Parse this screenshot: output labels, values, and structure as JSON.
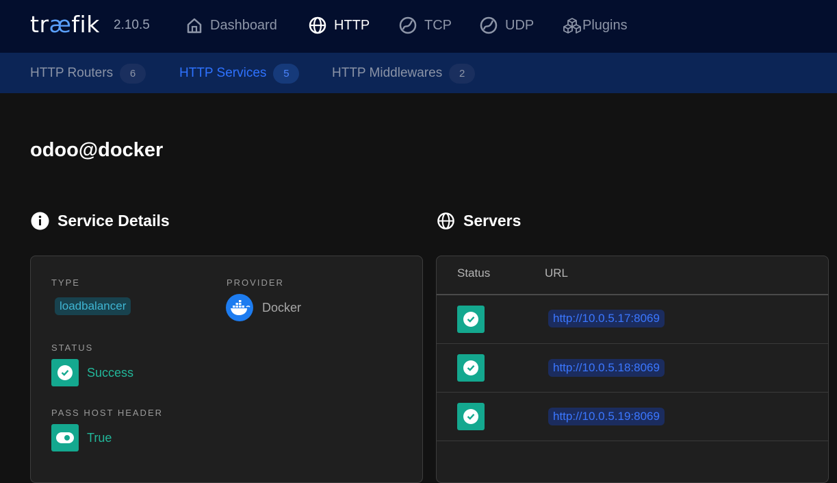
{
  "brand": {
    "logo_pre": "tr",
    "logo_ae": "æ",
    "logo_post": "fik",
    "version": "2.10.5"
  },
  "nav": {
    "dashboard": "Dashboard",
    "http": "HTTP",
    "tcp": "TCP",
    "udp": "UDP",
    "plugins": "Plugins"
  },
  "subnav": {
    "routers": {
      "label": "HTTP Routers",
      "count": "6"
    },
    "services": {
      "label": "HTTP Services",
      "count": "5"
    },
    "middlewares": {
      "label": "HTTP Middlewares",
      "count": "2"
    }
  },
  "page": {
    "title": "odoo@docker"
  },
  "service_details": {
    "heading": "Service Details",
    "type_label": "TYPE",
    "type_value": "loadbalancer",
    "provider_label": "PROVIDER",
    "provider_value": "Docker",
    "status_label": "STATUS",
    "status_value": "Success",
    "pass_host_label": "PASS HOST HEADER",
    "pass_host_value": "True"
  },
  "servers": {
    "heading": "Servers",
    "col_status": "Status",
    "col_url": "URL",
    "rows": [
      {
        "url": "http://10.0.5.17:8069"
      },
      {
        "url": "http://10.0.5.18:8069"
      },
      {
        "url": "http://10.0.5.19:8069"
      }
    ]
  },
  "colors": {
    "accent": "#2e72ff",
    "success": "#14a88f",
    "nav_bg": "#030e2d",
    "subnav_bg": "#0c2556"
  },
  "icons": [
    "home-icon",
    "globe-icon",
    "tcp-icon",
    "udp-icon",
    "plugins-icon",
    "info-icon",
    "docker-icon",
    "check-icon",
    "toggle-icon"
  ]
}
